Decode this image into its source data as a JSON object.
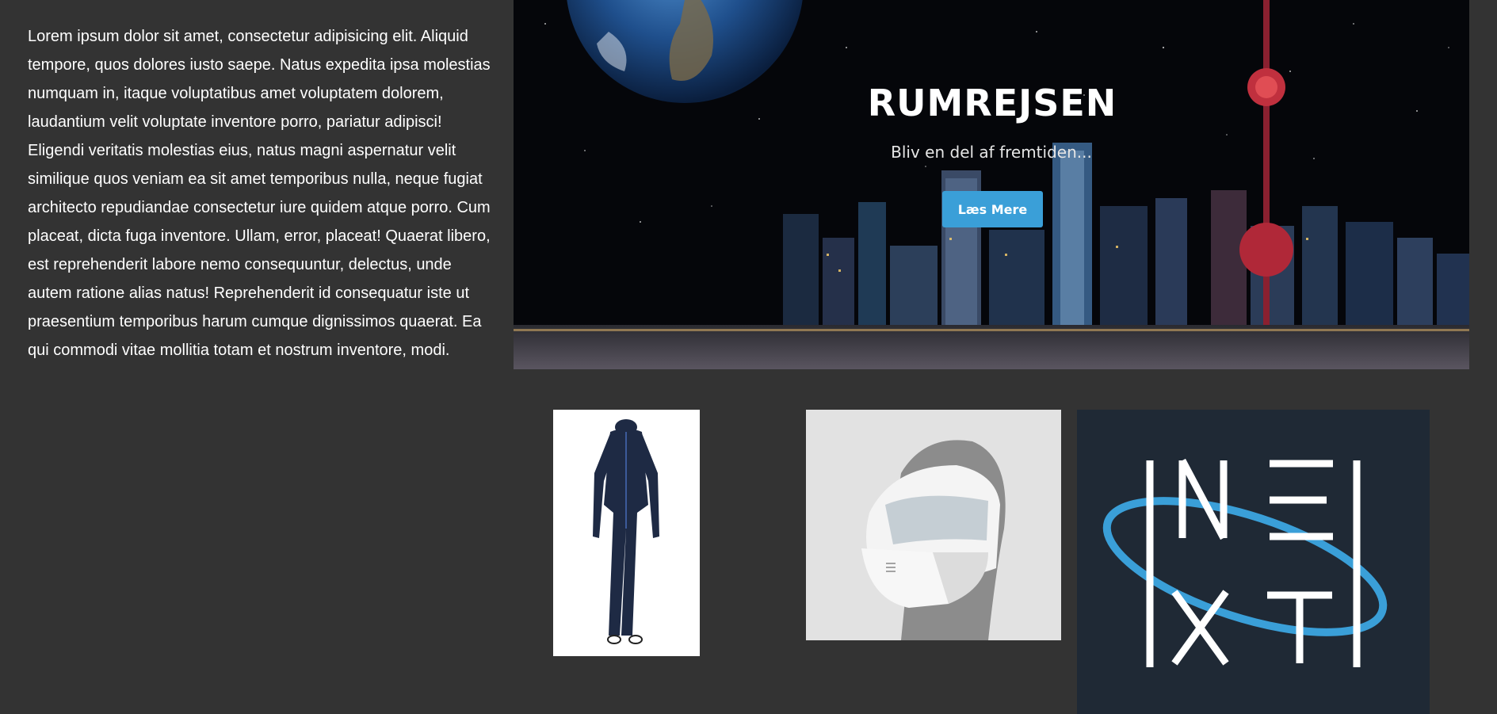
{
  "intro": {
    "paragraph": "Lorem ipsum dolor sit amet, consectetur adipisicing elit. Aliquid tempore, quos dolores iusto saepe. Natus expedita ipsa molestias numquam in, itaque voluptatibus amet voluptatem dolorem, laudantium velit voluptate inventore porro, pariatur adipisci! Eligendi veritatis molestias eius, natus magni aspernatur velit similique quos veniam ea sit amet temporibus nulla, neque fugiat architecto repudiandae consectetur iure quidem atque porro. Cum placeat, dicta fuga inventore. Ullam, error, placeat! Quaerat libero, est reprehenderit labore nemo consequuntur, delectus, unde autem ratione alias natus! Reprehenderit id consequatur iste ut praesentium temporibus harum cumque dignissimos quaerat. Ea qui commodi vitae mollitia totam et nostrum inventore, modi."
  },
  "hero": {
    "title": "RUMREJSEN",
    "subtitle": "Bliv en del af fremtiden...",
    "button_label": "Læs Mere",
    "button_color": "#3a9fd8"
  },
  "products": [
    {
      "icon": "space-suit-image"
    },
    {
      "icon": "space-helmet-mask-image"
    },
    {
      "icon": "next-logo-image",
      "logo_text": "NEXT"
    }
  ],
  "colors": {
    "page_background": "#333333",
    "text": "#ffffff",
    "logo_background": "#1f2935",
    "logo_orbit": "#3a9fd8"
  }
}
